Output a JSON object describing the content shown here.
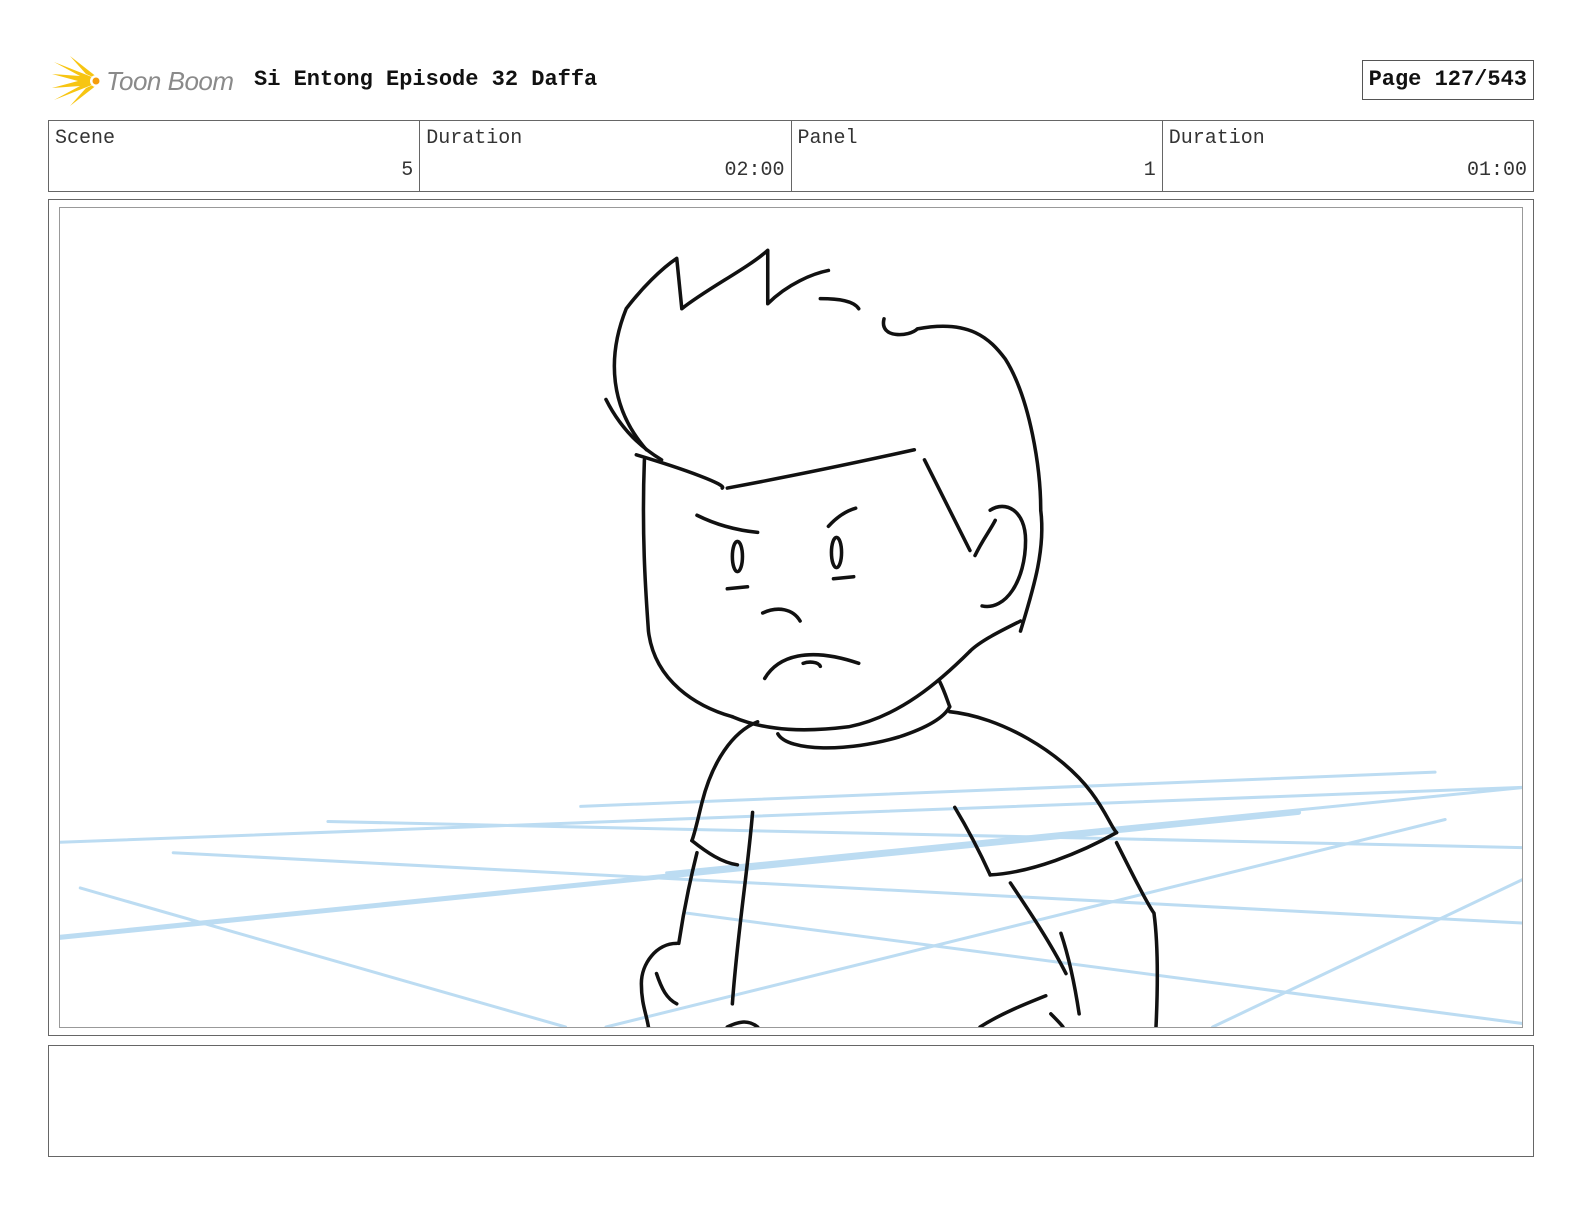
{
  "header": {
    "logo_text": "Toon Boom",
    "title": "Si Entong Episode 32 Daffa",
    "page_label": "Page 127/543"
  },
  "info": {
    "scene_label": "Scene",
    "scene_value": "5",
    "scene_duration_label": "Duration",
    "scene_duration_value": "02:00",
    "panel_label": "Panel",
    "panel_value": "1",
    "panel_duration_label": "Duration",
    "panel_duration_value": "01:00"
  },
  "panel": {
    "image_name": "storyboard-sketch",
    "guide_line_color": "#bcdcf2",
    "ink_color": "#111111"
  },
  "notes": {
    "text": ""
  },
  "colors": {
    "logo_flame": "#f7c512",
    "logo_text": "#8a8a8a",
    "border": "#666666"
  }
}
